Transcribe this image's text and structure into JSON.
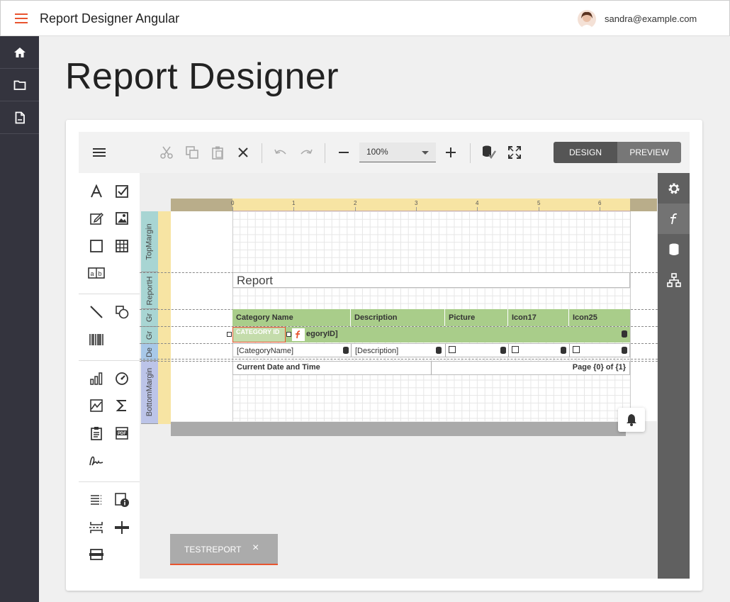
{
  "app": {
    "title": "Report Designer Angular",
    "user_email": "sandra@example.com"
  },
  "sidenav": {
    "items": [
      "home-icon",
      "folder-icon",
      "document-icon"
    ]
  },
  "page": {
    "title": "Report Designer"
  },
  "toolbar": {
    "zoom_value": "100%",
    "design_label": "DESIGN",
    "preview_label": "PREVIEW"
  },
  "ruler": {
    "numbers": [
      "0",
      "1",
      "2",
      "3",
      "4",
      "5",
      "6"
    ]
  },
  "bands": {
    "labels": [
      "TopMargin",
      "ReportH",
      "Gr",
      "Gr",
      "De",
      "BottomMargin"
    ]
  },
  "report": {
    "title": "Report",
    "headers": [
      "Category Name",
      "Description",
      "Picture",
      "Icon17",
      "Icon25"
    ],
    "group_field": "CATEGORY ID",
    "group_expr": "egoryID]",
    "detail": [
      "[CategoryName]",
      "[Description]"
    ],
    "footer_left": "Current Date and Time",
    "footer_right": "Page {0} of {1}"
  },
  "tab": {
    "label": "TESTREPORT",
    "close": "×"
  },
  "colors": {
    "accent": "#e8542f",
    "sidenav": "#34343e",
    "band_green": "#a9cd8a",
    "ruler": "#f7e4a3"
  }
}
